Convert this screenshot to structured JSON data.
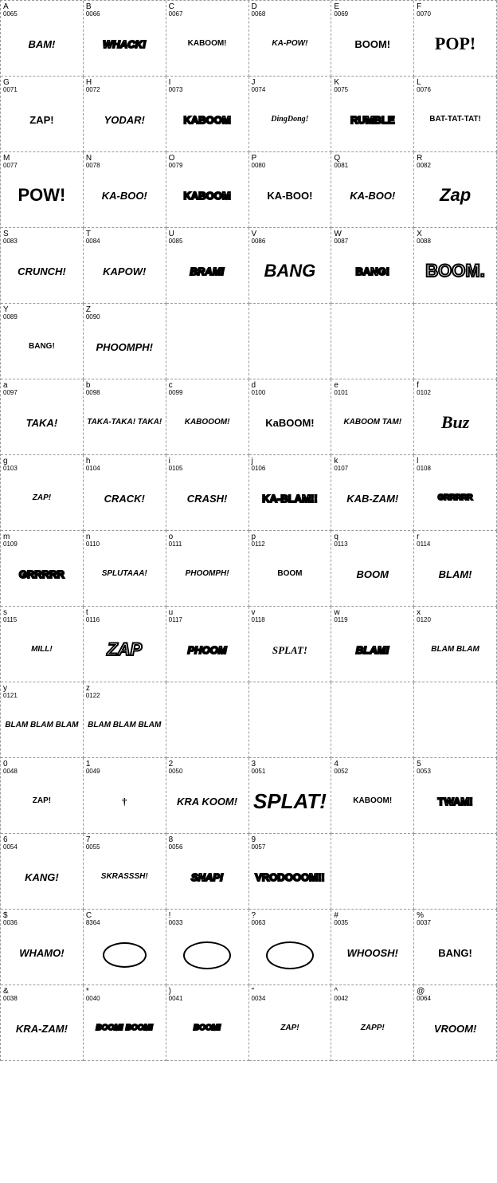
{
  "rows": [
    {
      "cells": [
        {
          "char": "A",
          "code": "0065",
          "text": "BAM!",
          "style": "small italic"
        },
        {
          "char": "B",
          "code": "0066",
          "text": "WHACK!",
          "style": "small italic outlined"
        },
        {
          "char": "C",
          "code": "0067",
          "text": "KABOOM!",
          "style": "xsmall"
        },
        {
          "char": "D",
          "code": "0068",
          "text": "KA-POW!",
          "style": "xsmall italic"
        },
        {
          "char": "E",
          "code": "0069",
          "text": "BOOM!",
          "style": "small"
        },
        {
          "char": "F",
          "code": "0070",
          "text": "POP!",
          "style": "large serif"
        }
      ]
    },
    {
      "cells": [
        {
          "char": "G",
          "code": "0071",
          "text": "ZAP!",
          "style": "small"
        },
        {
          "char": "H",
          "code": "0072",
          "text": "YODAR!",
          "style": "small italic"
        },
        {
          "char": "I",
          "code": "0073",
          "text": "KABOOM",
          "style": "small outlined"
        },
        {
          "char": "J",
          "code": "0074",
          "text": "DingDong!",
          "style": "xsmall italic serif"
        },
        {
          "char": "K",
          "code": "0075",
          "text": "RUMBLE",
          "style": "small outlined"
        },
        {
          "char": "L",
          "code": "0076",
          "text": "BAT-TAT-TAT!",
          "style": "xsmall"
        }
      ]
    },
    {
      "cells": [
        {
          "char": "M",
          "code": "0077",
          "text": "POW!",
          "style": "large"
        },
        {
          "char": "N",
          "code": "0078",
          "text": "KA-BOO!",
          "style": "small italic"
        },
        {
          "char": "O",
          "code": "0079",
          "text": "KABOOM",
          "style": "small outlined"
        },
        {
          "char": "P",
          "code": "0080",
          "text": "KA-BOO!",
          "style": "small"
        },
        {
          "char": "Q",
          "code": "0081",
          "text": "KA-BOO!",
          "style": "small italic"
        },
        {
          "char": "R",
          "code": "0082",
          "text": "Zap",
          "style": "large italic"
        }
      ]
    },
    {
      "cells": [
        {
          "char": "S",
          "code": "0083",
          "text": "CRUNCH!",
          "style": "small italic"
        },
        {
          "char": "T",
          "code": "0084",
          "text": "KAPOW!",
          "style": "small italic"
        },
        {
          "char": "U",
          "code": "0085",
          "text": "BRAM!",
          "style": "small italic outlined"
        },
        {
          "char": "V",
          "code": "0086",
          "text": "BANG",
          "style": "large italic"
        },
        {
          "char": "W",
          "code": "0087",
          "text": "BANG!",
          "style": "medium outlined"
        },
        {
          "char": "X",
          "code": "0088",
          "text": "BOOM.",
          "style": "large outlined"
        }
      ]
    },
    {
      "cells": [
        {
          "char": "Y",
          "code": "0089",
          "text": "BANG!",
          "style": "xsmall"
        },
        {
          "char": "Z",
          "code": "0090",
          "text": "PHOOMPH!",
          "style": "small italic"
        },
        {
          "char": "",
          "code": "",
          "text": "",
          "style": "empty"
        },
        {
          "char": "",
          "code": "",
          "text": "",
          "style": "empty"
        },
        {
          "char": "",
          "code": "",
          "text": "",
          "style": "empty"
        },
        {
          "char": "",
          "code": "",
          "text": "",
          "style": "empty"
        }
      ]
    },
    {
      "cells": [
        {
          "char": "a",
          "code": "0097",
          "text": "TAKA!",
          "style": "small italic"
        },
        {
          "char": "b",
          "code": "0098",
          "text": "TAKA-TAKA! TAKA!",
          "style": "xsmall italic"
        },
        {
          "char": "c",
          "code": "0099",
          "text": "KABOOOM!",
          "style": "xsmall italic"
        },
        {
          "char": "d",
          "code": "0100",
          "text": "KaBOOM!",
          "style": "small"
        },
        {
          "char": "e",
          "code": "0101",
          "text": "KABOOM TAM!",
          "style": "xsmall italic"
        },
        {
          "char": "f",
          "code": "0102",
          "text": "Buz",
          "style": "large serif italic"
        }
      ]
    },
    {
      "cells": [
        {
          "char": "g",
          "code": "0103",
          "text": "ZAP!",
          "style": "xsmall italic"
        },
        {
          "char": "h",
          "code": "0104",
          "text": "CRACK!",
          "style": "small italic"
        },
        {
          "char": "i",
          "code": "0105",
          "text": "CRASH!",
          "style": "small italic"
        },
        {
          "char": "j",
          "code": "0106",
          "text": "KA-BLAM!!",
          "style": "small outlined"
        },
        {
          "char": "k",
          "code": "0107",
          "text": "KAB-ZAM!",
          "style": "small italic"
        },
        {
          "char": "l",
          "code": "0108",
          "text": "GRRRRR",
          "style": "xsmall outlined"
        }
      ]
    },
    {
      "cells": [
        {
          "char": "m",
          "code": "0109",
          "text": "GRRRRR",
          "style": "small outlined"
        },
        {
          "char": "n",
          "code": "0110",
          "text": "SPLUTAAA!",
          "style": "xsmall italic"
        },
        {
          "char": "o",
          "code": "0111",
          "text": "PHOOMPH!",
          "style": "xsmall italic"
        },
        {
          "char": "p",
          "code": "0112",
          "text": "BOOM",
          "style": "xsmall"
        },
        {
          "char": "q",
          "code": "0113",
          "text": "BOOM",
          "style": "small italic"
        },
        {
          "char": "r",
          "code": "0114",
          "text": "BLAM!",
          "style": "small italic"
        }
      ]
    },
    {
      "cells": [
        {
          "char": "s",
          "code": "0115",
          "text": "MILL!",
          "style": "xsmall italic"
        },
        {
          "char": "t",
          "code": "0116",
          "text": "ZAP",
          "style": "large italic outlined"
        },
        {
          "char": "u",
          "code": "0117",
          "text": "PHOOM",
          "style": "small italic outlined"
        },
        {
          "char": "v",
          "code": "0118",
          "text": "SPLAT!",
          "style": "medium serif italic"
        },
        {
          "char": "w",
          "code": "0119",
          "text": "BLAM!",
          "style": "small italic outlined"
        },
        {
          "char": "x",
          "code": "0120",
          "text": "BLAM BLAM",
          "style": "xsmall italic"
        }
      ]
    },
    {
      "cells": [
        {
          "char": "y",
          "code": "0121",
          "text": "BLAM BLAM BLAM",
          "style": "xsmall italic"
        },
        {
          "char": "z",
          "code": "0122",
          "text": "BLAM BLAM BLAM",
          "style": "xsmall italic"
        },
        {
          "char": "",
          "code": "",
          "text": "",
          "style": "empty"
        },
        {
          "char": "",
          "code": "",
          "text": "",
          "style": "empty"
        },
        {
          "char": "",
          "code": "",
          "text": "",
          "style": "empty"
        },
        {
          "char": "",
          "code": "",
          "text": "",
          "style": "empty"
        }
      ]
    },
    {
      "cells": [
        {
          "char": "0",
          "code": "0048",
          "text": "ZAP!",
          "style": "xsmall"
        },
        {
          "char": "1",
          "code": "0049",
          "text": "†",
          "style": "medium serif"
        },
        {
          "char": "2",
          "code": "0050",
          "text": "KRA KOOM!",
          "style": "small italic"
        },
        {
          "char": "3",
          "code": "0051",
          "text": "SPLAT!",
          "style": "xlarge italic"
        },
        {
          "char": "4",
          "code": "0052",
          "text": "KABOOM!",
          "style": "xsmall"
        },
        {
          "char": "5",
          "code": "0053",
          "text": "TWAM!",
          "style": "medium outlined"
        }
      ]
    },
    {
      "cells": [
        {
          "char": "6",
          "code": "0054",
          "text": "KANG!",
          "style": "medium italic"
        },
        {
          "char": "7",
          "code": "0055",
          "text": "SKRASSSH!",
          "style": "xsmall italic"
        },
        {
          "char": "8",
          "code": "0056",
          "text": "SNAP!",
          "style": "small italic outlined"
        },
        {
          "char": "9",
          "code": "0057",
          "text": "VRODOOOM!!",
          "style": "medium outlined"
        },
        {
          "char": "",
          "code": "",
          "text": "",
          "style": "empty"
        },
        {
          "char": "",
          "code": "",
          "text": "",
          "style": "empty"
        }
      ]
    },
    {
      "cells": [
        {
          "char": "$",
          "code": "0036",
          "text": "WHAMO!",
          "style": "small italic"
        },
        {
          "char": "C",
          "code": "8364",
          "text": "",
          "style": "bubble"
        },
        {
          "char": "!",
          "code": "0033",
          "text": "",
          "style": "bubble-oval"
        },
        {
          "char": "?",
          "code": "0063",
          "text": "",
          "style": "bubble-oval"
        },
        {
          "char": "#",
          "code": "0035",
          "text": "WHOOSH!",
          "style": "small italic"
        },
        {
          "char": "%",
          "code": "0037",
          "text": "BANG!",
          "style": "small"
        }
      ]
    },
    {
      "cells": [
        {
          "char": "&",
          "code": "0038",
          "text": "KRA-ZAM!",
          "style": "small italic"
        },
        {
          "char": "*",
          "code": "0040",
          "text": "BOOM! BOOM!",
          "style": "xsmall italic outlined"
        },
        {
          "char": ")",
          "code": "0041",
          "text": "BOOM!",
          "style": "xsmall italic outlined"
        },
        {
          "char": "\"",
          "code": "0034",
          "text": "ZAP!",
          "style": "xsmall italic"
        },
        {
          "char": "^",
          "code": "0042",
          "text": "ZAPP!",
          "style": "xsmall italic"
        },
        {
          "char": "@",
          "code": "0064",
          "text": "VROOM!",
          "style": "small italic"
        }
      ]
    }
  ]
}
